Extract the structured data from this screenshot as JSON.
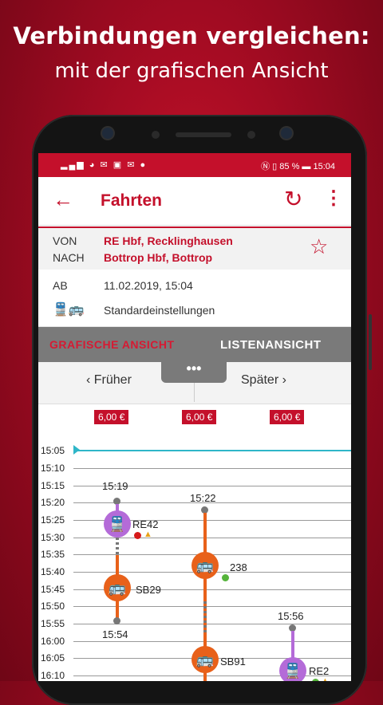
{
  "promo": {
    "headline": "Verbindungen vergleichen:",
    "subline": "mit der grafischen Ansicht"
  },
  "statusbar": {
    "left_icons": "▂▄▆ ◕ ✉ ▣ ✉ ●",
    "right": "Ⓝ ▯ 85 % ▬ 15:04"
  },
  "appbar": {
    "back_icon": "←",
    "title": "Fahrten",
    "refresh_icon": "↻",
    "more_icon": "⋮"
  },
  "route": {
    "from_label": "VON",
    "to_label": "NACH",
    "from_value": "RE Hbf, Recklinghausen",
    "to_value": "Bottrop Hbf, Bottrop",
    "star_icon": "☆"
  },
  "departure": {
    "label": "AB",
    "value": "11.02.2019, 15:04"
  },
  "settings": {
    "icon": "🚆🚌",
    "value": "Standardeinstellungen"
  },
  "tabs": {
    "graphic": "GRAFISCHE ANSICHT",
    "list": "LISTENANSICHT"
  },
  "nav": {
    "earlier": "‹  Früher",
    "later": "Später  ›",
    "handle": "•••"
  },
  "prices": [
    "6,00 €",
    "6,00 €",
    "6,00 €"
  ],
  "time_scale": [
    "15:05",
    "15:10",
    "15:15",
    "15:20",
    "15:25",
    "15:30",
    "15:35",
    "15:40",
    "15:45",
    "15:50",
    "15:55",
    "16:00",
    "16:05",
    "16:10"
  ],
  "connections": [
    {
      "depart": "15:19",
      "arrive": "15:54",
      "legs": [
        {
          "line": "RE42",
          "mode": "train",
          "color": "#b46bd8"
        },
        {
          "line": "SB29",
          "mode": "bus",
          "color": "#e8611a"
        }
      ]
    },
    {
      "depart": "15:22",
      "legs": [
        {
          "line": "238",
          "mode": "bus",
          "color": "#e8611a"
        },
        {
          "line": "SB91",
          "mode": "bus",
          "color": "#e8611a"
        }
      ]
    },
    {
      "depart": "15:56",
      "legs": [
        {
          "line": "RE2",
          "mode": "train",
          "color": "#b46bd8"
        }
      ]
    }
  ],
  "colors": {
    "brand": "#c4102b",
    "train": "#b46bd8",
    "bus": "#e8611a",
    "now_line": "#2fb6c8",
    "status_ok": "#55b43a",
    "status_warn": "#e8a21a",
    "status_alert": "#d61a1a"
  }
}
